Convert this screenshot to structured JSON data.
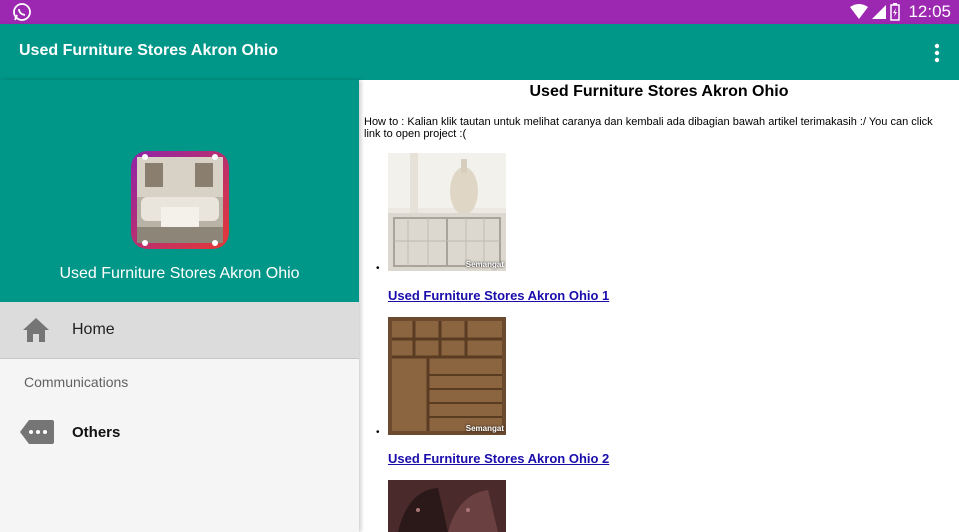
{
  "status_bar": {
    "time": "12:05"
  },
  "app_bar": {
    "title": "Used Furniture Stores Akron Ohio"
  },
  "drawer": {
    "app_name": "Used Furniture Stores Akron Ohio",
    "items": [
      {
        "label": "Home",
        "icon": "home-icon",
        "selected": true
      }
    ],
    "section_label": "Communications",
    "section_items": [
      {
        "label": "Others",
        "icon": "more-label-icon"
      }
    ]
  },
  "content": {
    "title": "Used Furniture Stores Akron Ohio",
    "howto": "How to : Kalian klik tautan untuk melihat caranya dan kembali ada dibagian bawah artikel terimakasih :/ You can click link to open project :(",
    "items": [
      {
        "link": "Used Furniture Stores Akron Ohio 1",
        "watermark": "Semangat"
      },
      {
        "link": "Used Furniture Stores Akron Ohio 2",
        "watermark": "Semangat"
      }
    ]
  },
  "colors": {
    "status_bar": "#9c27b0",
    "primary": "#009688",
    "link": "#1a0dab"
  }
}
